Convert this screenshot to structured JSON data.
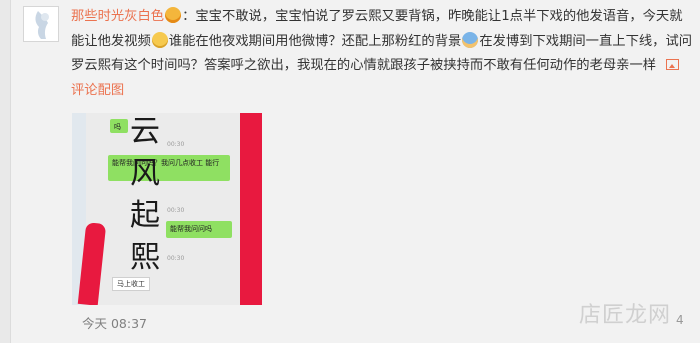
{
  "comment": {
    "username": "那些时光灰白色",
    "part1": "：宝宝不敢说，宝宝怕说了罗云熙又要背锅，昨晚能让1点半下戏的他发语音，今天就能让他发视频",
    "part2": "谁能在他夜戏期间用他微博？还配上那粉红的背景",
    "part3": "在发博到下戏期间一直上下线，试问罗云熙有这个时间吗？答案呼之欲出，我现在的心情就跟孩子被挟持而不敢有任何动作的老母亲一样",
    "pic_link": "评论配图",
    "emoji_names": [
      "crown-emoji",
      "awkward-face-emoji",
      "baby-emoji"
    ]
  },
  "image": {
    "top_char": "云",
    "char2": "风",
    "char3": "起",
    "char4": "熙",
    "bubble1": "能帮我问问吗？我问几点收工 能行",
    "bubble2": "能帮我问问吗",
    "time1": "00:30",
    "time2": "00:30",
    "time3": "00:30",
    "label": "马上收工",
    "small_top": "吗"
  },
  "footer": {
    "time": "今天 08:37",
    "watermark": "店匠龙网",
    "suffix": "4"
  }
}
